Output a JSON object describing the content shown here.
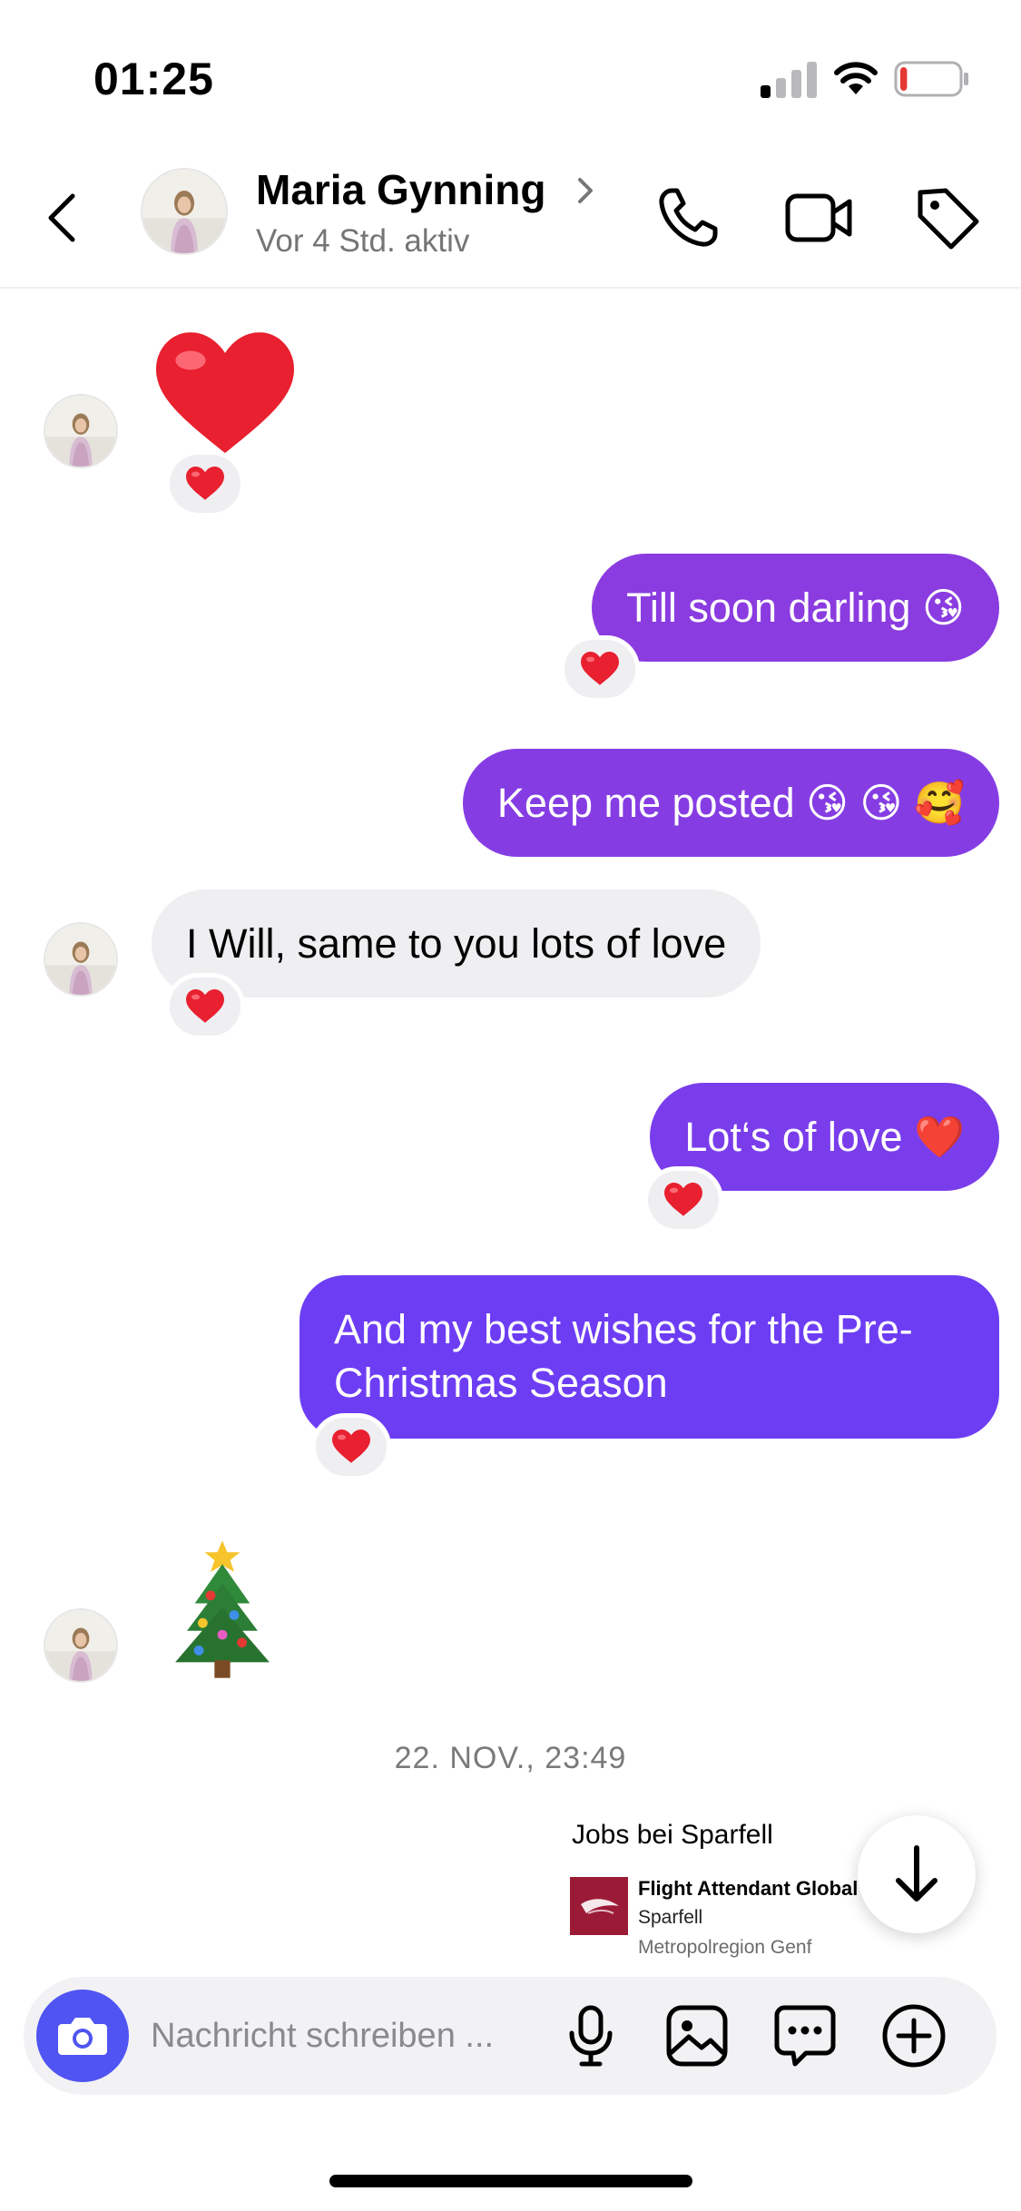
{
  "status_bar": {
    "time": "01:25",
    "battery_level": 0.12,
    "battery_color": "#e53935"
  },
  "header": {
    "contact_name": "Maria Gynning",
    "activity": "Vor 4 Std. aktiv",
    "icons": [
      "back-icon",
      "chevron-right-icon",
      "phone-icon",
      "video-camera-icon",
      "tag-icon"
    ]
  },
  "colors": {
    "out_bubble_start": "#8a3ce0",
    "out_bubble_end": "#6b3df5",
    "in_bubble": "#efeff2",
    "heart": "#e8202f",
    "camera_button": "#4f54f2"
  },
  "messages": [
    {
      "sender": "them",
      "type": "emoji",
      "content": "red-heart",
      "reaction": "❤️"
    },
    {
      "sender": "me",
      "text": "Till soon darling 😘",
      "reaction": "❤️"
    },
    {
      "sender": "me",
      "text": "Keep me posted 😘 😘 🥰"
    },
    {
      "sender": "them",
      "text": "I Will, same to you lots of love",
      "reaction": "❤️"
    },
    {
      "sender": "me",
      "text": "Lot‘s of love ❤️",
      "reaction": "❤️"
    },
    {
      "sender": "me",
      "text_line1": "And my best wishes for the Pre-",
      "text_line2": "Christmas Season",
      "reaction": "❤️"
    },
    {
      "sender": "them",
      "type": "emoji",
      "content": "christmas-tree"
    }
  ],
  "timestamp": "22. NOV., 23:49",
  "shared_job": {
    "heading": "Jobs bei Sparfell",
    "title": "Flight Attendant Global 7",
    "company": "Sparfell",
    "location": "Metropolregion Genf"
  },
  "composer": {
    "placeholder": "Nachricht schreiben ...",
    "icons": [
      "camera-icon",
      "microphone-icon",
      "image-icon",
      "chat-bubble-icon",
      "plus-circle-icon"
    ]
  }
}
